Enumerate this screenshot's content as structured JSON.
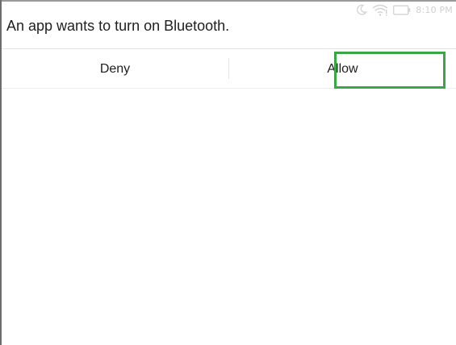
{
  "status_bar": {
    "time": "8:10 PM",
    "icons": [
      "moon-icon",
      "wifi-icon",
      "battery-icon"
    ]
  },
  "dialog": {
    "title": "An app wants to turn on Bluetooth.",
    "deny_label": "Deny",
    "allow_label": "Allow"
  },
  "colors": {
    "highlight": "#3aa646",
    "text": "#212121",
    "status_icons": "#d4d4d4"
  }
}
